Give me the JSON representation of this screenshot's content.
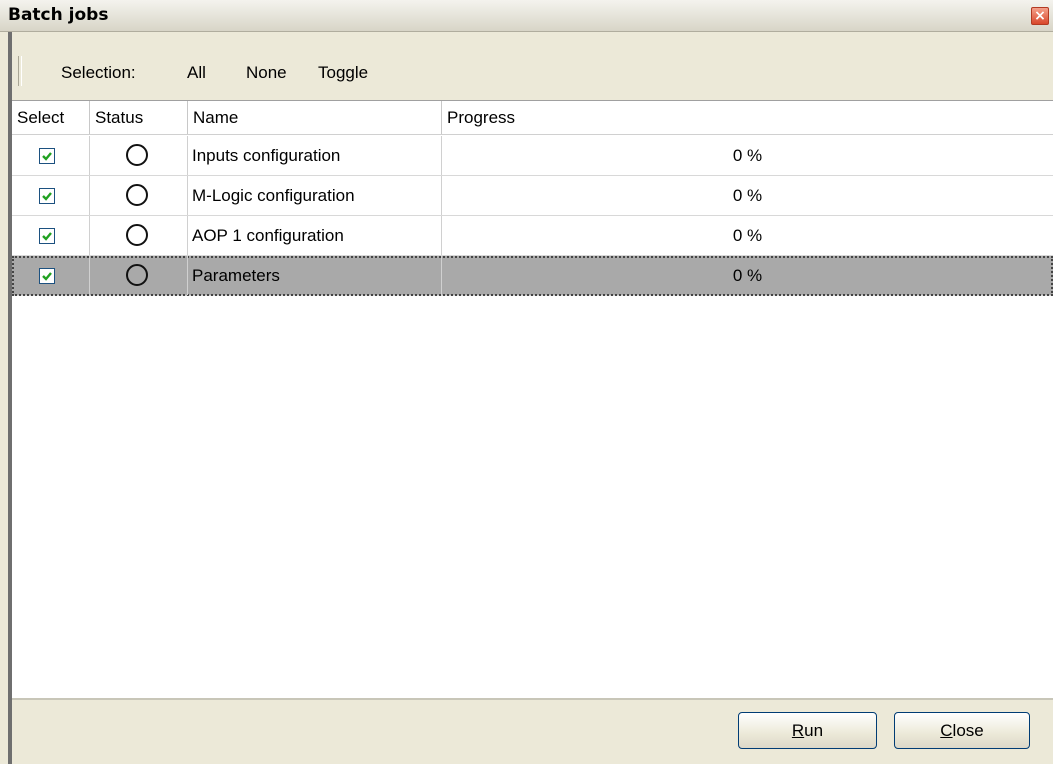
{
  "window": {
    "title": "Batch jobs",
    "close_glyph": "×"
  },
  "toolbar": {
    "selection_label": "Selection:",
    "all_label": "All",
    "none_label": "None",
    "toggle_label": "Toggle"
  },
  "table": {
    "columns": [
      "Select",
      "Status",
      "Name",
      "Progress"
    ],
    "rows": [
      {
        "checked": true,
        "status": "not-started",
        "name": "Inputs configuration",
        "progress": "0 %"
      },
      {
        "checked": true,
        "status": "not-started",
        "name": "M-Logic configuration",
        "progress": "0 %"
      },
      {
        "checked": true,
        "status": "not-started",
        "name": "AOP 1 configuration",
        "progress": "0 %"
      },
      {
        "checked": true,
        "status": "not-started",
        "name": "Parameters",
        "progress": "0 %",
        "selected": true
      }
    ]
  },
  "footer": {
    "run_mnemonic": "R",
    "run_rest": "un",
    "close_mnemonic": "C",
    "close_rest": "lose"
  },
  "colors": {
    "check": "#21a121",
    "selected_row": "#a9a9a9",
    "button_border": "#003c74"
  }
}
